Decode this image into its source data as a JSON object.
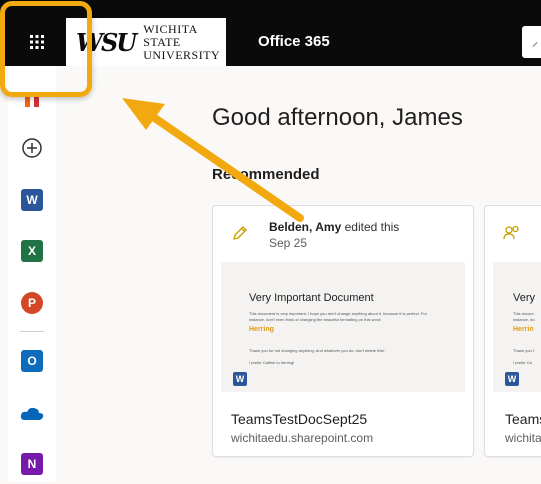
{
  "header": {
    "app_title": "Office 365",
    "logo": {
      "mark": "WSU",
      "line1": "WICHITA STATE",
      "line2": "UNIVERSITY"
    }
  },
  "rail": {
    "items": [
      {
        "name": "home-icon",
        "letter": ""
      },
      {
        "name": "create-icon",
        "letter": ""
      },
      {
        "name": "word-icon",
        "letter": "W",
        "color": "#2b579a"
      },
      {
        "name": "excel-icon",
        "letter": "X",
        "color": "#217346"
      },
      {
        "name": "powerpoint-icon",
        "letter": "P",
        "color": "#d24726"
      },
      {
        "name": "outlook-icon",
        "letter": "O",
        "color": "#0f6cbd"
      },
      {
        "name": "onedrive-icon",
        "letter": "",
        "color": "#0364b8"
      },
      {
        "name": "onenote-icon",
        "letter": "N",
        "color": "#7719aa"
      }
    ]
  },
  "main": {
    "greeting": "Good afternoon, James",
    "section_title": "Recommended"
  },
  "cards": [
    {
      "author": "Belden,  Amy",
      "action": "edited this",
      "date": "Sep 25",
      "preview": {
        "title": "Very Important Document",
        "line1": "This document is very important. I hope you don't change anything about it, because it is perfect. For",
        "line2": "instance, don't even think of changing the beautiful formatting on this word:",
        "highlight_word": "Herring",
        "line3": "Thank you for not changing anything. And whatever you do, don't delete this!",
        "line4": "I prefer Catfish to herring!"
      },
      "file_name": "TeamsTestDocSept25",
      "file_location": "wichitaedu.sharepoint.com"
    },
    {
      "preview": {
        "title": "Very",
        "line1": "This docum",
        "line2": "instance, do",
        "highlight_word": "Herrin",
        "line3": "Thank you f",
        "line4": "I prefer Ca"
      },
      "file_name": "Teams",
      "file_location": "wichita"
    }
  ],
  "annotation": {
    "color": "#f2a90f"
  }
}
